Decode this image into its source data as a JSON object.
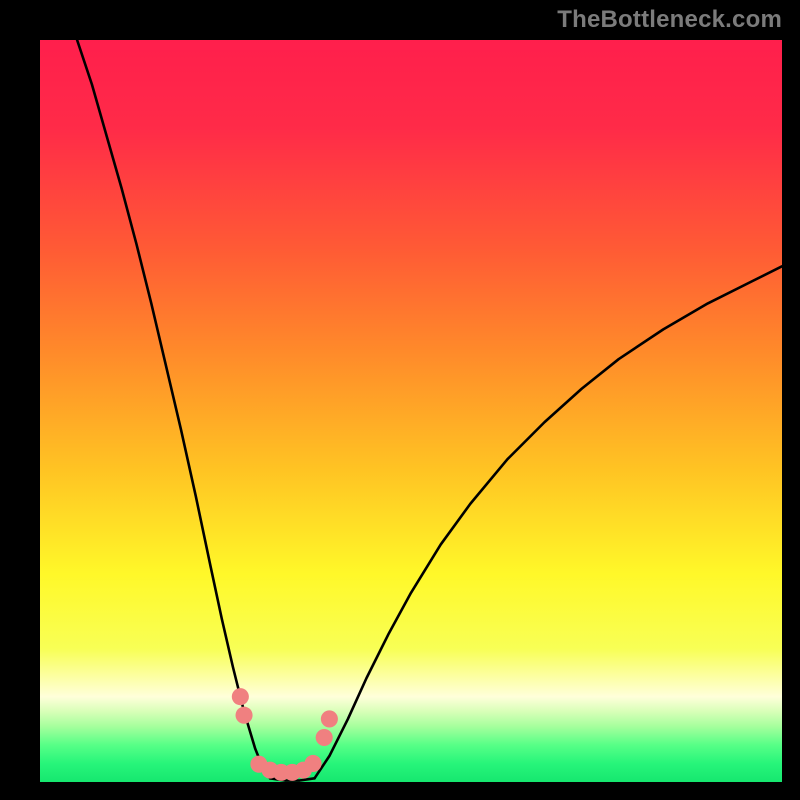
{
  "watermark": "TheBottleneck.com",
  "gradient_stops": [
    {
      "offset": 0.0,
      "color": "#ff1f4c"
    },
    {
      "offset": 0.12,
      "color": "#ff2b48"
    },
    {
      "offset": 0.28,
      "color": "#ff5a35"
    },
    {
      "offset": 0.42,
      "color": "#ff8a2a"
    },
    {
      "offset": 0.58,
      "color": "#ffc423"
    },
    {
      "offset": 0.72,
      "color": "#fff829"
    },
    {
      "offset": 0.82,
      "color": "#f8ff55"
    },
    {
      "offset": 0.885,
      "color": "#ffffda"
    },
    {
      "offset": 0.905,
      "color": "#d8ffb8"
    },
    {
      "offset": 0.925,
      "color": "#a6ff9d"
    },
    {
      "offset": 0.95,
      "color": "#57ff87"
    },
    {
      "offset": 0.975,
      "color": "#27f57a"
    },
    {
      "offset": 1.0,
      "color": "#16e76f"
    }
  ],
  "chart_data": {
    "type": "line",
    "title": "",
    "xlabel": "",
    "ylabel": "",
    "xlim": [
      0,
      100
    ],
    "ylim": [
      0,
      100
    ],
    "grid": false,
    "series": [
      {
        "name": "left_curve",
        "x": [
          5.0,
          7.0,
          9.0,
          11.0,
          13.0,
          15.0,
          17.0,
          19.0,
          21.0,
          23.0,
          24.5,
          26.0,
          27.5,
          29.0,
          30.0,
          31.0
        ],
        "y": [
          100.0,
          94.0,
          87.0,
          80.0,
          72.5,
          64.5,
          56.0,
          47.5,
          38.5,
          29.0,
          22.0,
          15.5,
          9.5,
          4.5,
          2.0,
          0.5
        ]
      },
      {
        "name": "valley_floor",
        "x": [
          31.0,
          33.0,
          35.0,
          37.0
        ],
        "y": [
          0.5,
          0.2,
          0.2,
          0.5
        ]
      },
      {
        "name": "right_curve",
        "x": [
          37.0,
          39.0,
          41.5,
          44.0,
          47.0,
          50.0,
          54.0,
          58.0,
          63.0,
          68.0,
          73.0,
          78.0,
          84.0,
          90.0,
          96.0,
          100.0
        ],
        "y": [
          0.5,
          3.5,
          8.5,
          14.0,
          20.0,
          25.5,
          32.0,
          37.5,
          43.5,
          48.5,
          53.0,
          57.0,
          61.0,
          64.5,
          67.5,
          69.5
        ]
      }
    ],
    "markers": [
      {
        "name": "left_pair",
        "x": [
          27.0,
          27.5
        ],
        "y": [
          11.5,
          9.0
        ]
      },
      {
        "name": "bottom_run",
        "x": [
          29.5,
          31.0,
          32.5,
          34.0,
          35.5,
          36.8
        ],
        "y": [
          2.4,
          1.6,
          1.3,
          1.3,
          1.6,
          2.5
        ]
      },
      {
        "name": "right_pair",
        "x": [
          38.3,
          39.0
        ],
        "y": [
          6.0,
          8.5
        ]
      }
    ],
    "marker_style": {
      "color": "#f08080",
      "radius_pct": 1.15
    }
  }
}
